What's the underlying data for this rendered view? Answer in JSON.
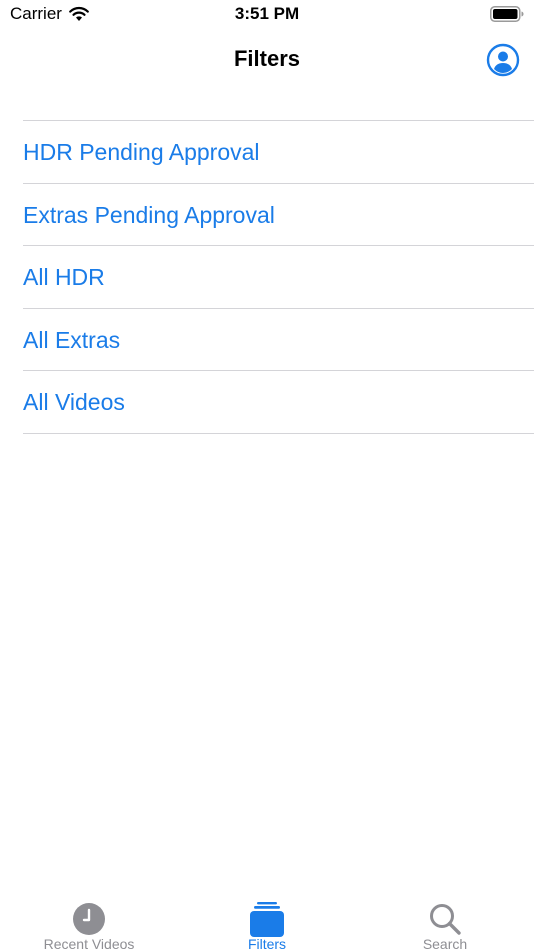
{
  "status_bar": {
    "carrier": "Carrier",
    "time": "3:51 PM"
  },
  "nav": {
    "title": "Filters",
    "profile_icon": "person-circle-icon"
  },
  "filters": [
    {
      "label": "HDR Pending Approval"
    },
    {
      "label": "Extras Pending Approval"
    },
    {
      "label": "All HDR"
    },
    {
      "label": "All Extras"
    },
    {
      "label": "All Videos"
    }
  ],
  "tab_bar": {
    "tabs": [
      {
        "label": "Recent Videos",
        "icon": "clock-icon",
        "active": false
      },
      {
        "label": "Filters",
        "icon": "stack-icon",
        "active": true
      },
      {
        "label": "Search",
        "icon": "magnifying-glass-icon",
        "active": false
      }
    ]
  },
  "colors": {
    "accent": "#1a7ce8",
    "inactive": "#8e8e93",
    "separator": "#d4d4d8"
  }
}
